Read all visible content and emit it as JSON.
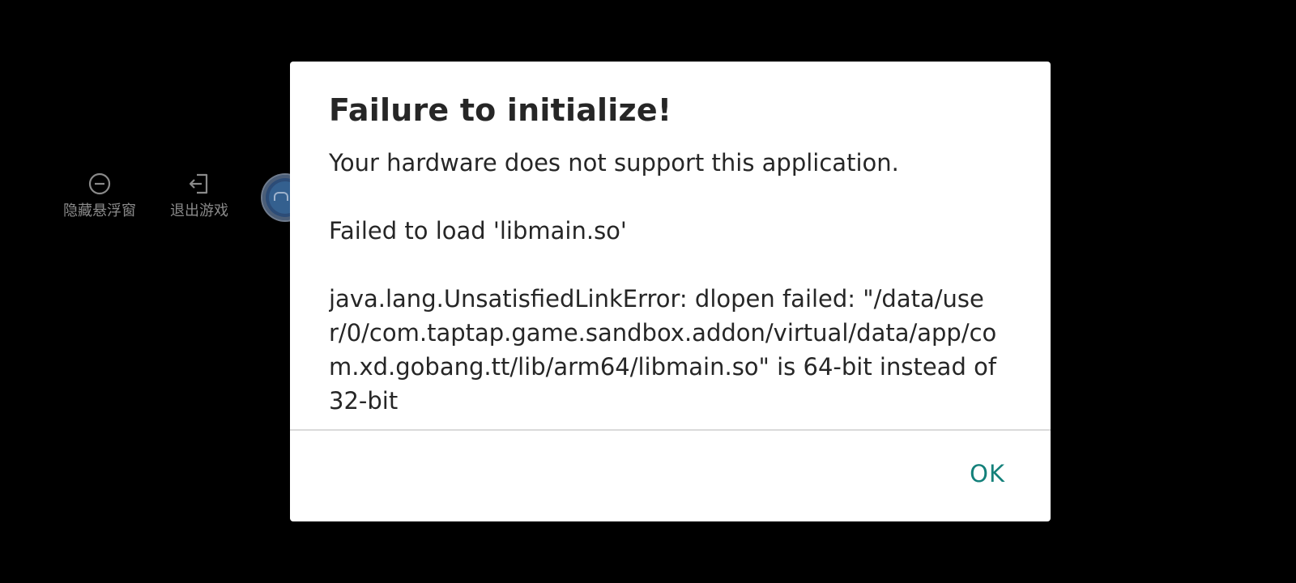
{
  "float_window": {
    "hide_label": "隐藏悬浮窗",
    "hide_icon": "minus-circle-icon",
    "exit_label": "退出游戏",
    "exit_icon": "logout-icon",
    "avatar_icon": "game-avatar-icon"
  },
  "dialog": {
    "title": "Failure to initialize!",
    "message": "Your hardware does not support this application.",
    "load_error": "Failed to load 'libmain.so'",
    "exception": "java.lang.UnsatisfiedLinkError: dlopen failed: \"/data/user/0/com.taptap.game.sandbox.addon/virtual/data/app/com.xd.gobang.tt/lib/arm64/libmain.so\" is 64-bit instead of 32-bit",
    "ok_label": "OK"
  },
  "colors": {
    "background": "#000000",
    "dialog_bg": "#ffffff",
    "text": "#262626",
    "accent": "#13807a",
    "divider": "#dadada",
    "float_text": "#8a8a8a"
  }
}
